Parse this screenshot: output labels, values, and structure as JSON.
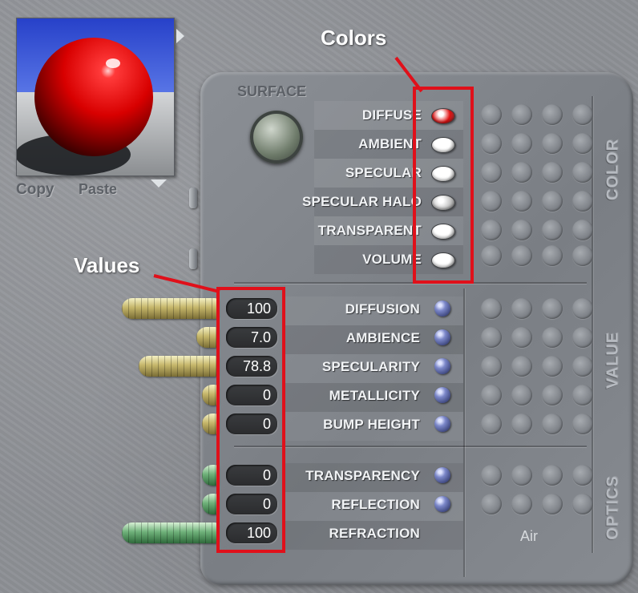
{
  "preview": {
    "copy_label": "Copy",
    "paste_label": "Paste"
  },
  "surface": {
    "title": "SURFACE",
    "sphere_icon": "texture-sphere-icon"
  },
  "annotations": {
    "colors_label": "Colors",
    "values_label": "Values",
    "color": "#e0101a"
  },
  "sections": {
    "color": "COLOR",
    "value": "VALUE",
    "optics": "OPTICS"
  },
  "columns": [
    "A",
    "B",
    "C",
    "D"
  ],
  "color_rows": [
    {
      "label": "DIFFUSE",
      "swatch": "#e01010"
    },
    {
      "label": "AMBIENT",
      "swatch": "#ffffff"
    },
    {
      "label": "SPECULAR",
      "swatch": "#ffffff"
    },
    {
      "label": "SPECULAR HALO",
      "swatch": "#c8c8c8"
    },
    {
      "label": "TRANSPARENT",
      "swatch": "#ffffff"
    },
    {
      "label": "VOLUME",
      "swatch": "#ffffff"
    }
  ],
  "value_rows": [
    {
      "label": "DIFFUSION",
      "value": "100",
      "level": 1.0
    },
    {
      "label": "AMBIENCE",
      "value": "7.0",
      "level": 0.07
    },
    {
      "label": "SPECULARITY",
      "value": "78.8",
      "level": 0.788
    },
    {
      "label": "METALLICITY",
      "value": "0",
      "level": 0
    },
    {
      "label": "BUMP HEIGHT",
      "value": "0",
      "level": 0
    }
  ],
  "optics_rows": [
    {
      "label": "TRANSPARENCY",
      "value": "0",
      "level": 0
    },
    {
      "label": "REFLECTION",
      "value": "0",
      "level": 0
    },
    {
      "label": "REFRACTION",
      "value": "100",
      "level": 1.0
    }
  ],
  "refraction_medium": "Air"
}
